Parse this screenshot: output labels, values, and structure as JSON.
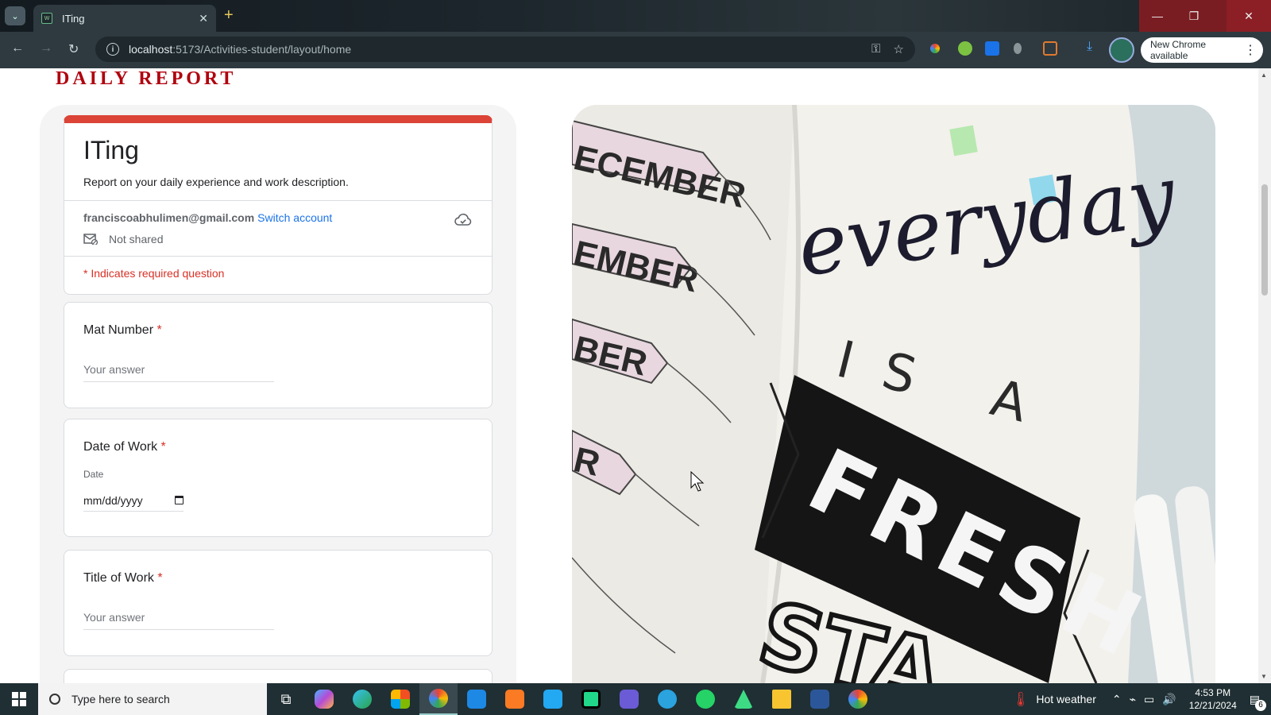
{
  "browser": {
    "tab_title": "ITing",
    "url_host": "localhost",
    "url_path": ":5173/Activities-student/layout/home",
    "update_button_label": "New Chrome available"
  },
  "page": {
    "report_heading": "DAILY REPORT"
  },
  "form": {
    "title": "ITing",
    "description": "Report on your daily experience and work description.",
    "account_email": "franciscoabhulimen@gmail.com",
    "switch_account_label": "Switch account",
    "shared_status": "Not shared",
    "required_note": "* Indicates required question",
    "questions": [
      {
        "title": "Mat Number",
        "required_marker": "*",
        "placeholder": "Your answer"
      },
      {
        "title": "Date of Work",
        "required_marker": "*",
        "sublabel": "Date",
        "value": "mm/dd/yyyy"
      },
      {
        "title": "Title of Work",
        "required_marker": "*",
        "placeholder": "Your answer"
      }
    ]
  },
  "hero_image": {
    "alt": "everyday IS A FRESH START",
    "months": [
      "ECEMBER",
      "EMBER",
      "BER",
      "R"
    ],
    "lettering_script": "everyday",
    "lettering_mid": "IS A",
    "lettering_banner": "FRESH",
    "lettering_bottom": "STA"
  },
  "taskbar": {
    "search_placeholder": "Type here to search",
    "weather": "Hot weather",
    "time": "4:53 PM",
    "date": "12/21/2024",
    "notification_count": "6"
  },
  "colors": {
    "form_accent": "#db4437",
    "heading_red": "#b0000e",
    "link_blue": "#1a73e8",
    "required_red": "#d93025"
  }
}
